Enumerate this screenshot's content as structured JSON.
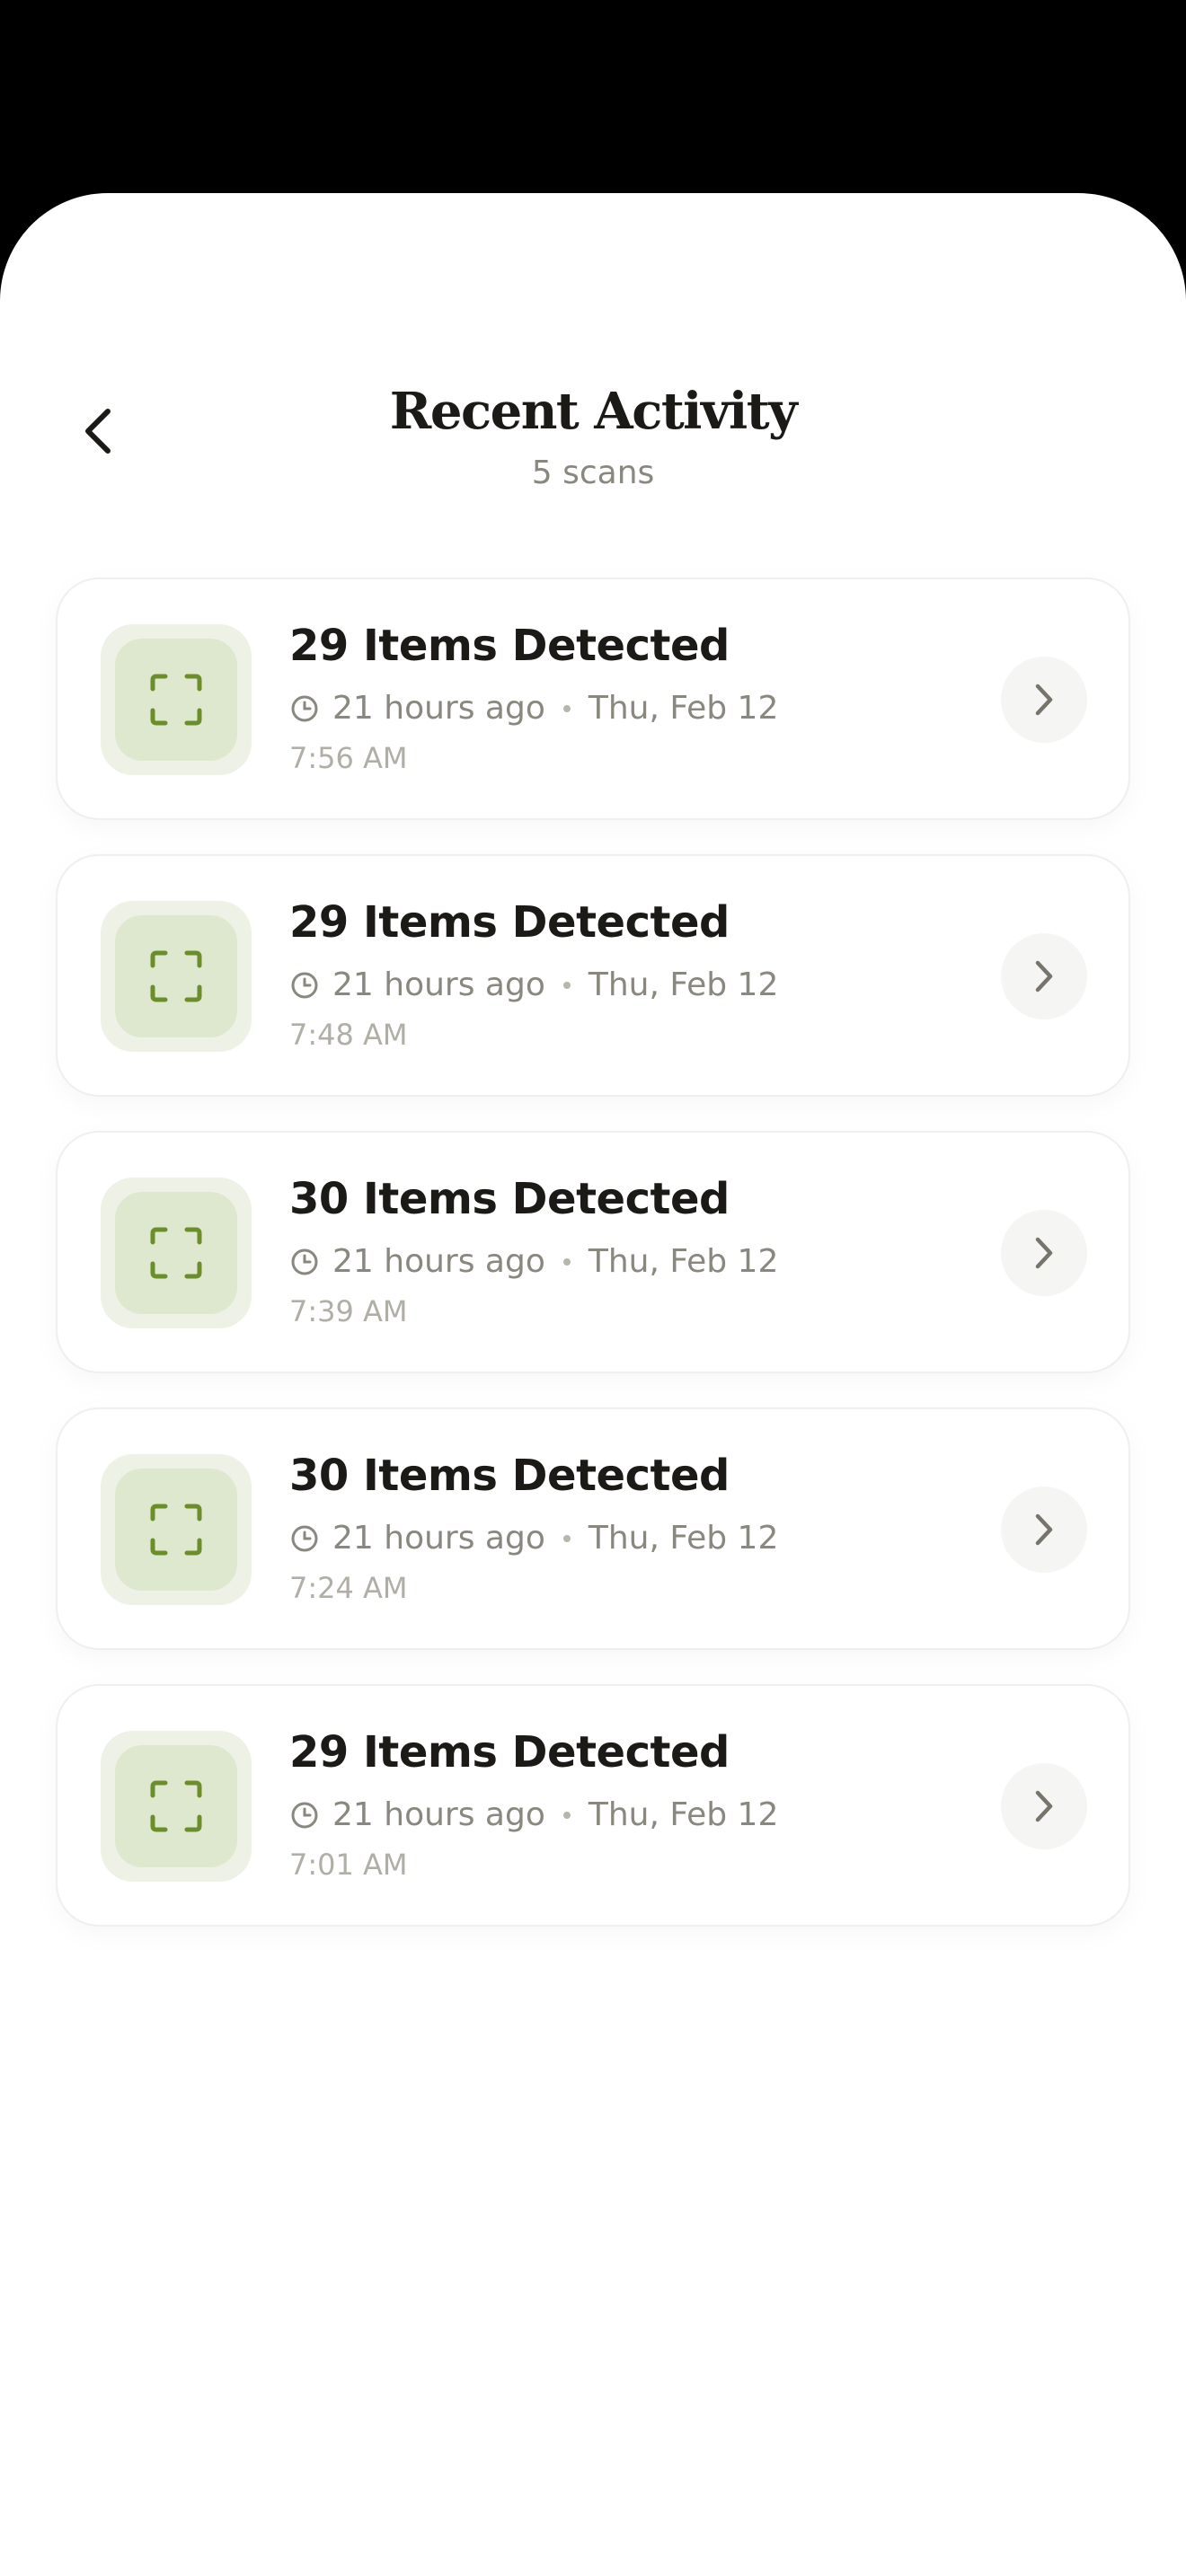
{
  "header": {
    "title": "Recent Activity",
    "subtitle": "5 scans"
  },
  "colors": {
    "accent": "#6b8e2a",
    "thumb_bg": "#dee8cf"
  },
  "icons": {
    "back": "chevron-left-icon",
    "scan": "scan-frame-icon",
    "clock": "clock-icon",
    "open": "chevron-right-icon"
  },
  "scans": [
    {
      "title": "29 Items Detected",
      "relative": "21 hours ago",
      "date": "Thu, Feb 12",
      "time": "7:56 AM"
    },
    {
      "title": "29 Items Detected",
      "relative": "21 hours ago",
      "date": "Thu, Feb 12",
      "time": "7:48 AM"
    },
    {
      "title": "30 Items Detected",
      "relative": "21 hours ago",
      "date": "Thu, Feb 12",
      "time": "7:39 AM"
    },
    {
      "title": "30 Items Detected",
      "relative": "21 hours ago",
      "date": "Thu, Feb 12",
      "time": "7:24 AM"
    },
    {
      "title": "29 Items Detected",
      "relative": "21 hours ago",
      "date": "Thu, Feb 12",
      "time": "7:01 AM"
    }
  ]
}
